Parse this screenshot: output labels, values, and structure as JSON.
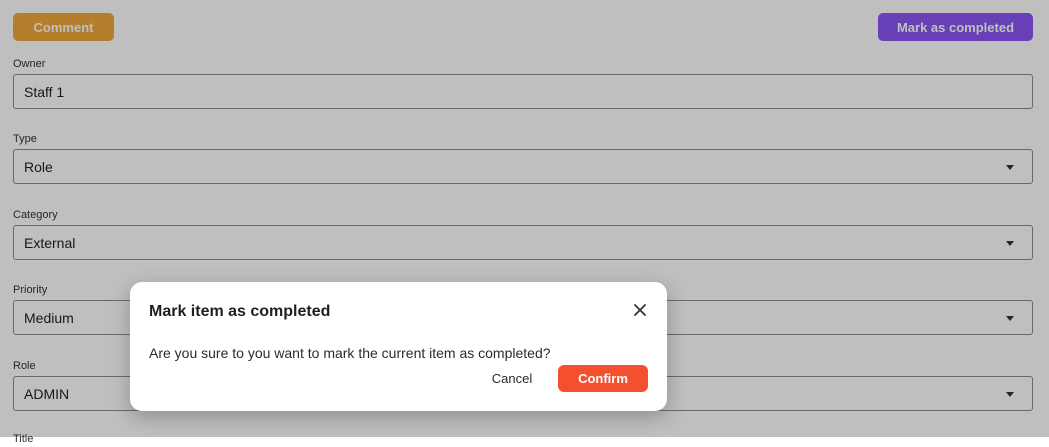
{
  "toolbar": {
    "comment_label": "Comment",
    "complete_label": "Mark as completed"
  },
  "form": {
    "owner": {
      "label": "Owner",
      "value": "Staff 1"
    },
    "type": {
      "label": "Type",
      "value": "Role"
    },
    "category": {
      "label": "Category",
      "value": "External"
    },
    "priority": {
      "label": "Priority",
      "value": "Medium"
    },
    "role": {
      "label": "Role",
      "value": "ADMIN"
    },
    "title": {
      "label": "Title"
    }
  },
  "dialog": {
    "title": "Mark item as completed",
    "message": "Are you sure to you want to mark the current item as completed?",
    "cancel_label": "Cancel",
    "confirm_label": "Confirm"
  },
  "colors": {
    "comment_button": "#f2a93b",
    "complete_button": "#8a55f3",
    "confirm_button": "#f4502f",
    "overlay": "rgba(0,0,0,0.25)"
  },
  "icons": {
    "close": "close-icon",
    "dropdown": "chevron-down-icon"
  }
}
